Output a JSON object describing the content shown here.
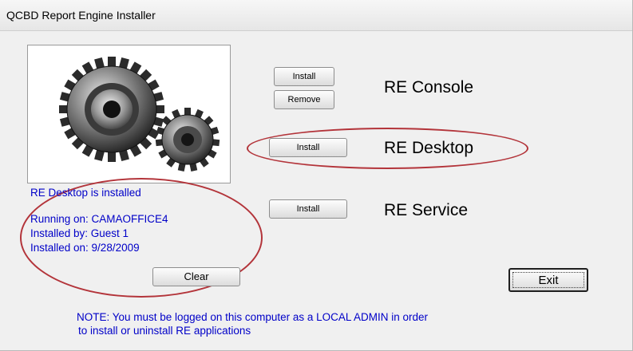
{
  "window": {
    "title": "QCBD Report Engine Installer"
  },
  "gear_image": {
    "icon": "gears-icon"
  },
  "re_console": {
    "install_label": "Install",
    "remove_label": "Remove",
    "title": "RE Console"
  },
  "re_desktop": {
    "install_label": "Install",
    "title": "RE Desktop"
  },
  "re_service": {
    "install_label": "Install",
    "title": "RE Service"
  },
  "status": {
    "installed_text": "RE Desktop is installed",
    "running_on": "Running on: CAMAOFFICE4",
    "installed_by": "Installed by: Guest 1",
    "installed_on": "Installed on: 9/28/2009",
    "clear_label": "Clear"
  },
  "exit_label": "Exit",
  "note": {
    "line1": "NOTE: You must be logged on this computer as a LOCAL ADMIN in order",
    "line2": "to install or uninstall RE applications"
  },
  "colors": {
    "info_text": "#0000c8",
    "highlight_ellipse": "#b3343a"
  }
}
